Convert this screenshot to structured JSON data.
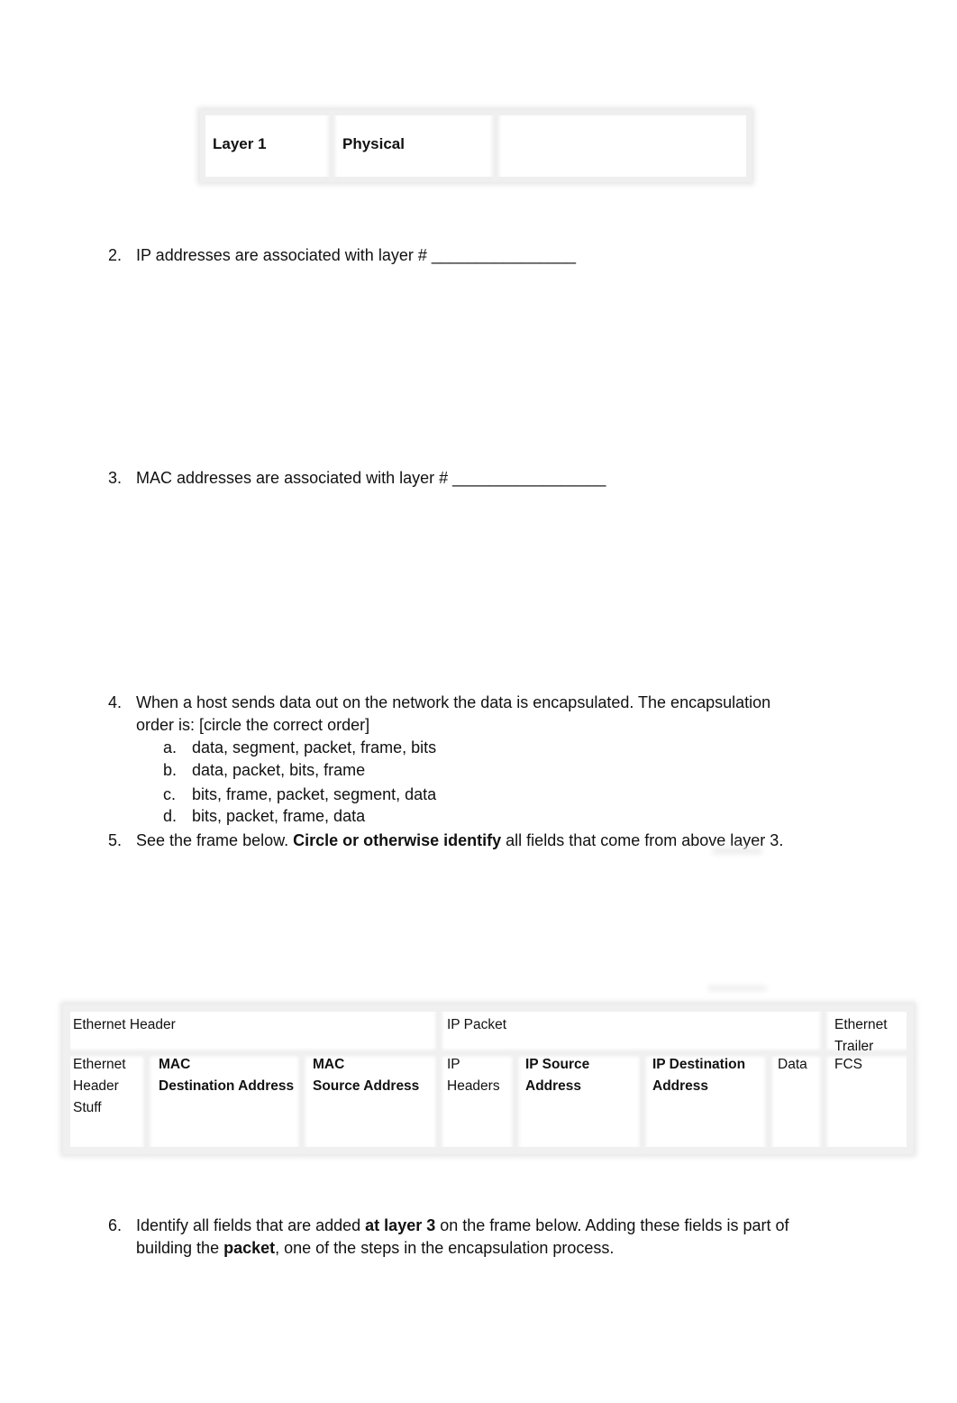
{
  "layer_table": {
    "layer": "Layer 1",
    "name": "Physical",
    "answer": ""
  },
  "questions": [
    {
      "number": "2.",
      "text": "IP addresses are associated with layer # ",
      "blank": "________________"
    },
    {
      "number": "3.",
      "text": "MAC addresses are associated with layer # ",
      "blank": "_________________"
    },
    {
      "number": "4.",
      "line1": "When a host sends data out on the network the data is encapsulated.  The encapsulation",
      "line2": "order is:  [circle the correct order]",
      "options": [
        {
          "label": "a.",
          "text": "data, segment, packet, frame, bits"
        },
        {
          "label": "b.",
          "text": "data, packet, bits, frame"
        },
        {
          "label": "c.",
          "text": "bits, frame, packet, segment, data"
        },
        {
          "label": "d.",
          "text": "bits, packet, frame, data"
        }
      ]
    },
    {
      "number": "5.",
      "pre": "See the frame below.  ",
      "bold": "Circle or otherwise identify",
      "post": " all fields that come from above layer 3."
    },
    {
      "number": "6.",
      "pre": "Identify all fields that are added ",
      "bold1": "at layer 3",
      "mid": " on the frame below.  Adding these fields is part of",
      "line2_pre": "building the ",
      "bold2": "packet",
      "line2_post": ", one of the steps in the encapsulation process."
    }
  ],
  "frame_table": {
    "groups": {
      "ethernet_header": "Ethernet Header",
      "ip_packet": "IP Packet",
      "ethernet_trailer_1": "Ethernet",
      "ethernet_trailer_2": "Trailer"
    },
    "fields": {
      "eth_stuff": [
        "Ethernet",
        "Header",
        "Stuff"
      ],
      "mac_dest": [
        "MAC",
        "Destination Address"
      ],
      "mac_src": [
        "MAC",
        "Source Address"
      ],
      "ip_headers": [
        "IP",
        "Headers"
      ],
      "ip_src": [
        "IP Source",
        "Address"
      ],
      "ip_dest": [
        "IP Destination",
        "Address"
      ],
      "data": "Data",
      "fcs": "FCS"
    }
  }
}
